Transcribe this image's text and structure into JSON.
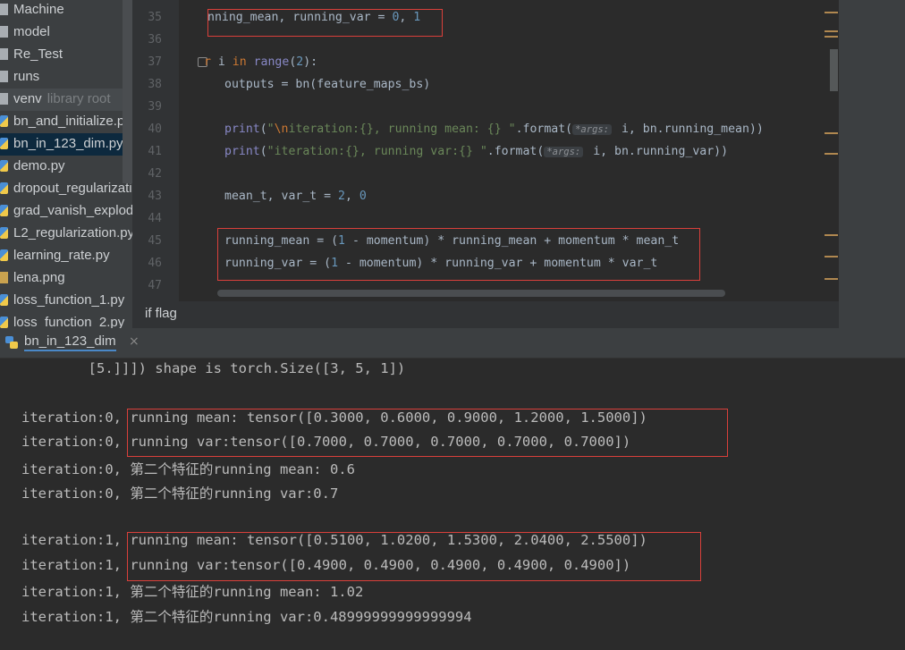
{
  "project_tree": [
    {
      "label": "Machine",
      "type": "folder"
    },
    {
      "label": "model",
      "type": "folder"
    },
    {
      "label": "Re_Test",
      "type": "folder"
    },
    {
      "label": "runs",
      "type": "folder"
    },
    {
      "label": "venv",
      "suffix": "library root",
      "type": "folder"
    },
    {
      "label": "bn_and_initialize.py",
      "type": "py"
    },
    {
      "label": "bn_in_123_dim.py",
      "type": "py",
      "selected": true
    },
    {
      "label": "demo.py",
      "type": "py"
    },
    {
      "label": "dropout_regularization.py",
      "type": "py"
    },
    {
      "label": "grad_vanish_explod.py",
      "type": "py"
    },
    {
      "label": "L2_regularization.py",
      "type": "py"
    },
    {
      "label": "learning_rate.py",
      "type": "py"
    },
    {
      "label": "lena.png",
      "type": "png"
    },
    {
      "label": "loss_function_1.py",
      "type": "py"
    },
    {
      "label": "loss_function_2.py",
      "type": "py"
    }
  ],
  "editor": {
    "line_numbers": [
      "35",
      "36",
      "37",
      "38",
      "39",
      "40",
      "41",
      "42",
      "43",
      "44",
      "45",
      "46",
      "47"
    ],
    "line35": {
      "a": "nning_mean, running_var = ",
      "n1": "0",
      "c": ", ",
      "n2": "1"
    },
    "line37": {
      "kw1": "r ",
      "v": "i ",
      "kw2": "in ",
      "fn": "range",
      "p1": "(",
      "n": "2",
      "p2": "):"
    },
    "line38": "outputs = bn(feature_maps_bs)",
    "line40": {
      "fn": "print",
      "p": "(",
      "q": "\"",
      "esc": "\\n",
      "s": "iteration:{}, running mean: {} \"",
      "fmt": ".format(",
      "hint": "*args:",
      "rest": " i, bn.running_mean))"
    },
    "line41": {
      "fn": "print",
      "p": "(",
      "s": "\"iteration:{}, running var:{} \"",
      "fmt": ".format(",
      "hint": "*args:",
      "rest": " i, bn.running_var))"
    },
    "line43": {
      "a": "mean_t, var_t = ",
      "n1": "2",
      "c": ", ",
      "n2": "0"
    },
    "line45": {
      "a": "running_mean = (",
      "n": "1",
      "b": " - momentum) * running_mean + momentum * mean_t"
    },
    "line46": {
      "a": "running_var = (",
      "n": "1",
      "b": " - momentum) * running_var + momentum * var_t"
    }
  },
  "breadcrumb": "if flag",
  "run_tab": {
    "label": "bn_in_123_dim",
    "close": "×"
  },
  "console": [
    "        [5.]]]) shape is torch.Size([3, 5, 1])",
    "",
    "iteration:0, running mean: tensor([0.3000, 0.6000, 0.9000, 1.2000, 1.5000])",
    "iteration:0, running var:tensor([0.7000, 0.7000, 0.7000, 0.7000, 0.7000])",
    "iteration:0, 第二个特征的running mean: 0.6",
    "iteration:0, 第二个特征的running var:0.7",
    "",
    "iteration:1, running mean: tensor([0.5100, 1.0200, 1.5300, 2.0400, 2.5500])",
    "iteration:1, running var:tensor([0.4900, 0.4900, 0.4900, 0.4900, 0.4900])",
    "iteration:1, 第二个特征的running mean: 1.02",
    "iteration:1, 第二个特征的running var:0.48999999999999994"
  ],
  "colors": {
    "highlight_box": "#d9403b",
    "keyword": "#cc7832",
    "number": "#6897bb",
    "string": "#6a8759"
  }
}
